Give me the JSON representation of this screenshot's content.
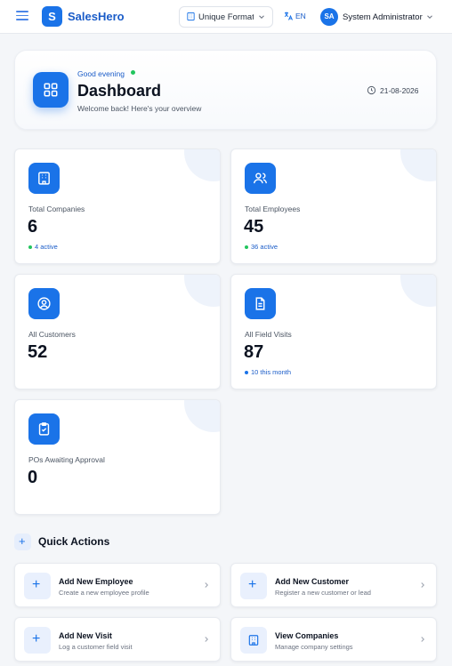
{
  "topbar": {
    "brand_letter": "S",
    "brand": "SalesHero",
    "company_select": "Unique Formations",
    "language": "EN",
    "user_initials": "SA",
    "user_name": "System Administrator"
  },
  "header": {
    "greeting": "Good evening",
    "title": "Dashboard",
    "subtitle": "Welcome back! Here's your overview",
    "date": "21-08-2026"
  },
  "stats": [
    {
      "label": "Total Companies",
      "value": "6",
      "sub": "4 active",
      "icon": "building-icon"
    },
    {
      "label": "Total Employees",
      "value": "45",
      "sub": "36 active",
      "icon": "users-icon"
    },
    {
      "label": "All Customers",
      "value": "52",
      "icon": "user-circle-icon"
    },
    {
      "label": "All Field Visits",
      "value": "87",
      "sub": "10 this month",
      "icon": "document-icon"
    },
    {
      "label": "POs Awaiting Approval",
      "value": "0",
      "icon": "clipboard-check-icon"
    }
  ],
  "quick_actions": {
    "title": "Quick Actions",
    "items": [
      {
        "title": "Add New Employee",
        "subtitle": "Create a new employee profile",
        "icon": "plus-icon"
      },
      {
        "title": "Add New Customer",
        "subtitle": "Register a new customer or lead",
        "icon": "plus-icon"
      },
      {
        "title": "Add New Visit",
        "subtitle": "Log a customer field visit",
        "icon": "plus-icon"
      },
      {
        "title": "View Companies",
        "subtitle": "Manage company settings",
        "icon": "building-icon"
      }
    ]
  },
  "colors": {
    "accent": "#1a73e8",
    "active_green": "#22c55e",
    "month_blue": "#1a73e8"
  }
}
